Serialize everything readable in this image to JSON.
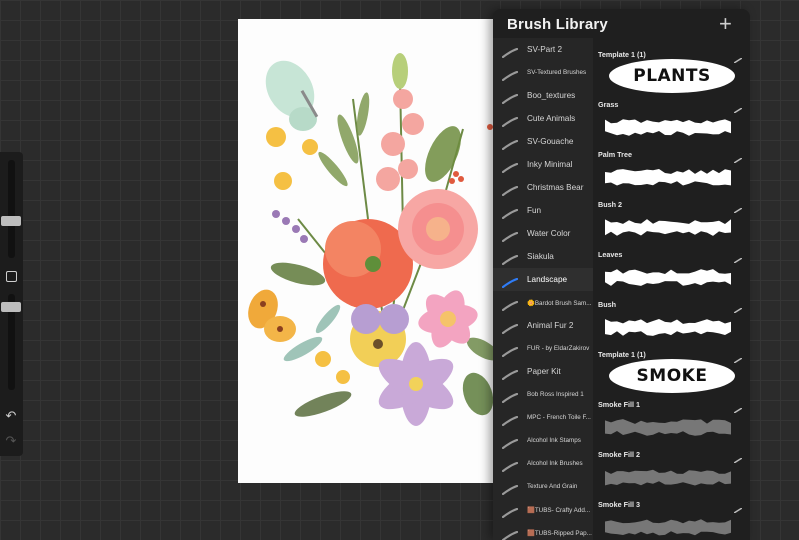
{
  "toolbar": {
    "undo_icon": "undo-arrow-icon",
    "redo_icon": "redo-arrow-icon",
    "square_icon": "modify-square-icon"
  },
  "panel": {
    "title": "Brush Library",
    "add_icon": "plus-icon",
    "sets": [
      {
        "label": "SV-Part 2",
        "small": false
      },
      {
        "label": "SV-Textured Brushes",
        "small": true
      },
      {
        "label": "Boo_textures",
        "small": false
      },
      {
        "label": "Cute Animals",
        "small": false
      },
      {
        "label": "SV-Gouache",
        "small": false
      },
      {
        "label": "Inky Minimal",
        "small": false
      },
      {
        "label": "Christmas Bear",
        "small": false
      },
      {
        "label": "Fun",
        "small": false
      },
      {
        "label": "Water Color",
        "small": false
      },
      {
        "label": "Siakula",
        "small": false
      },
      {
        "label": "Landscape",
        "small": false,
        "active": true
      },
      {
        "label": "🌼Bardot Brush Sam...",
        "small": true
      },
      {
        "label": "Animal Fur 2",
        "small": false
      },
      {
        "label": "FUR - by EldarZakirov",
        "small": true
      },
      {
        "label": "Paper Kit",
        "small": false
      },
      {
        "label": "Bob Ross Inspired 1",
        "small": true
      },
      {
        "label": "MPC - French Toile F...",
        "small": true
      },
      {
        "label": "Alcohol Ink Stamps",
        "small": true
      },
      {
        "label": "Alcohol Ink Brushes",
        "small": true
      },
      {
        "label": "Texture And Grain",
        "small": true
      },
      {
        "label": "🟫TUBS- Crafty Add...",
        "small": true
      },
      {
        "label": "🟫TUBS-Ripped Pap...",
        "small": true
      }
    ],
    "brushes": [
      {
        "name": "Template 1 (1)",
        "kind": "pill",
        "pill": "PLANTS"
      },
      {
        "name": "Grass",
        "kind": "white"
      },
      {
        "name": "Palm Tree",
        "kind": "white"
      },
      {
        "name": "Bush 2",
        "kind": "white"
      },
      {
        "name": "Leaves",
        "kind": "white"
      },
      {
        "name": "Bush",
        "kind": "white"
      },
      {
        "name": "Template 1 (1)",
        "kind": "pill",
        "pill": "SMOKE"
      },
      {
        "name": "Smoke Fill 1",
        "kind": "smoke"
      },
      {
        "name": "Smoke Fill 2",
        "kind": "smoke"
      },
      {
        "name": "Smoke Fill 3",
        "kind": "smoke"
      }
    ]
  },
  "canvas": {
    "artwork": "watercolor floral bouquet with butterflies"
  }
}
